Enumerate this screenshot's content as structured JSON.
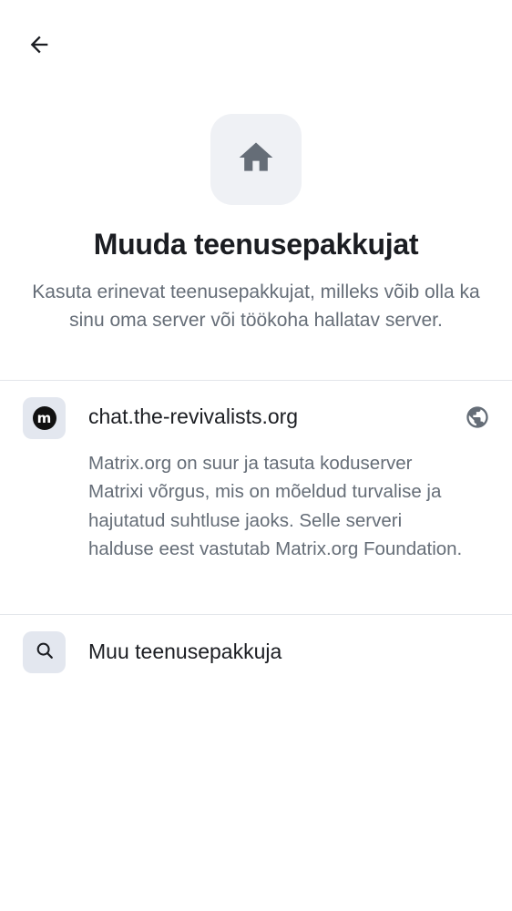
{
  "header": {
    "back_icon": "arrow-left-icon"
  },
  "hero": {
    "icon": "home-icon",
    "title": "Muuda teenusepakkujat",
    "subtitle": "Kasuta erinevat teenusepakkujat, milleks võib olla ka sinu oma server või töökoha hallatav server."
  },
  "servers": [
    {
      "logo_letter": "m",
      "name": "chat.the-revivalists.org",
      "trailing_icon": "globe-icon",
      "description": "Matrix.org on suur ja tasuta koduserver Matrixi võrgus, mis on mõeldud turvalise ja hajutatud suhtluse jaoks. Selle serveri halduse eest vastutab Matrix.org Foundation."
    }
  ],
  "other_provider": {
    "icon": "search-icon",
    "label": "Muu teenusepakkuja"
  },
  "colors": {
    "text_primary": "#1b1d22",
    "text_secondary": "#656d77",
    "icon_tile_bg": "#eff1f5",
    "row_icon_bg": "#e3e7ef",
    "divider": "#e3e6ea"
  }
}
